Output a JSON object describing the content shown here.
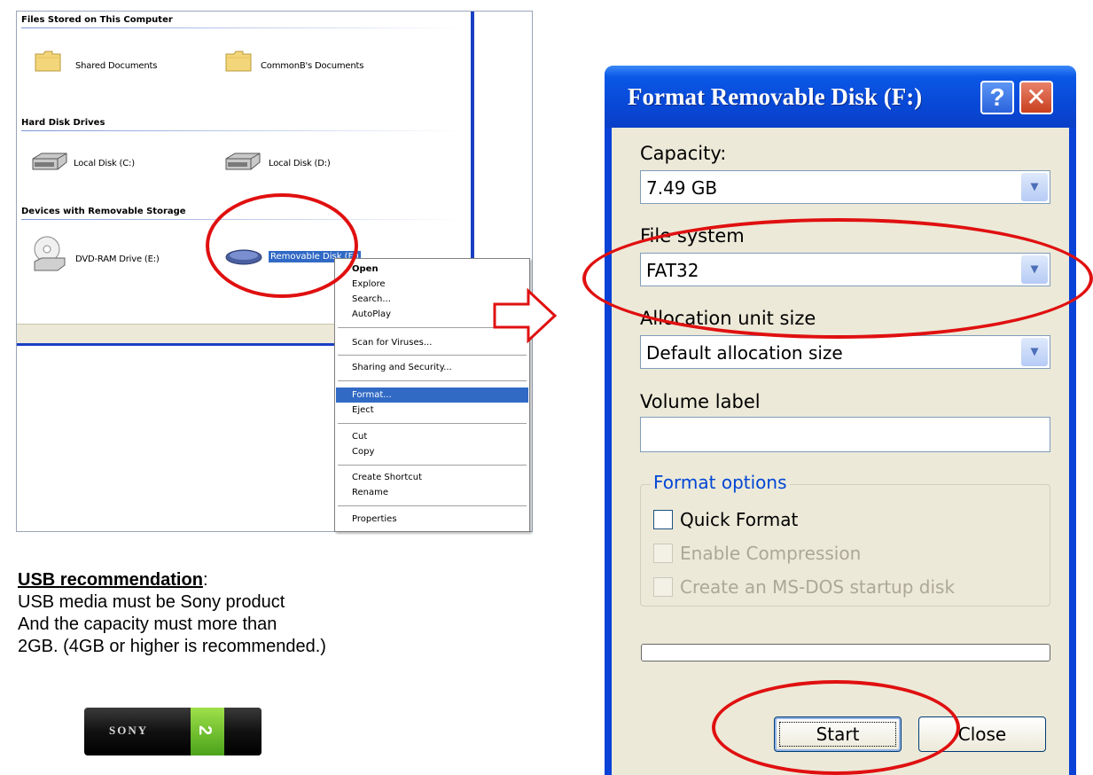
{
  "explorer": {
    "groups": {
      "stored": "Files Stored on This Computer",
      "hdd": "Hard Disk Drives",
      "removable": "Devices with Removable Storage"
    },
    "items": {
      "shared_docs": "Shared Documents",
      "commonb_docs": "CommonB's Documents",
      "local_c": "Local Disk (C:)",
      "local_d": "Local Disk (D:)",
      "dvd_ram": "DVD-RAM Drive (E:)",
      "removable_disk": "Removable Disk (F:)"
    },
    "context_menu": [
      "Open",
      "Explore",
      "Search...",
      "AutoPlay",
      "Scan for Viruses...",
      "Sharing and Security...",
      "Format...",
      "Eject",
      "Cut",
      "Copy",
      "Create Shortcut",
      "Rename",
      "Properties"
    ],
    "highlighted_menu_item": "Format..."
  },
  "usb_note": {
    "title": "USB recommendation",
    "title_suffix": ":",
    "lines": [
      "USB media must be Sony product",
      "And the capacity must more than",
      "2GB. (4GB or higher is recommended.)"
    ],
    "stick_brand": "SONY",
    "stick_capacity": "2"
  },
  "dialog": {
    "title": "Format Removable Disk (F:)",
    "help_glyph": "?",
    "close_glyph": "✕",
    "capacity_label": "Capacity:",
    "capacity_value": "7.49 GB",
    "filesystem_label": "File system",
    "filesystem_value": "FAT32",
    "allocation_label": "Allocation unit size",
    "allocation_value": "Default allocation size",
    "volume_label": "Volume label",
    "volume_value": "",
    "format_options_title": "Format options",
    "quick_format": "Quick Format",
    "enable_compression": "Enable Compression",
    "msdos_startup": "Create an MS-DOS startup disk",
    "start_button": "Start",
    "close_button": "Close"
  },
  "colors": {
    "annotation_red": "#e01010",
    "xp_blue": "#0a41d6",
    "selection_blue": "#316ac5"
  }
}
